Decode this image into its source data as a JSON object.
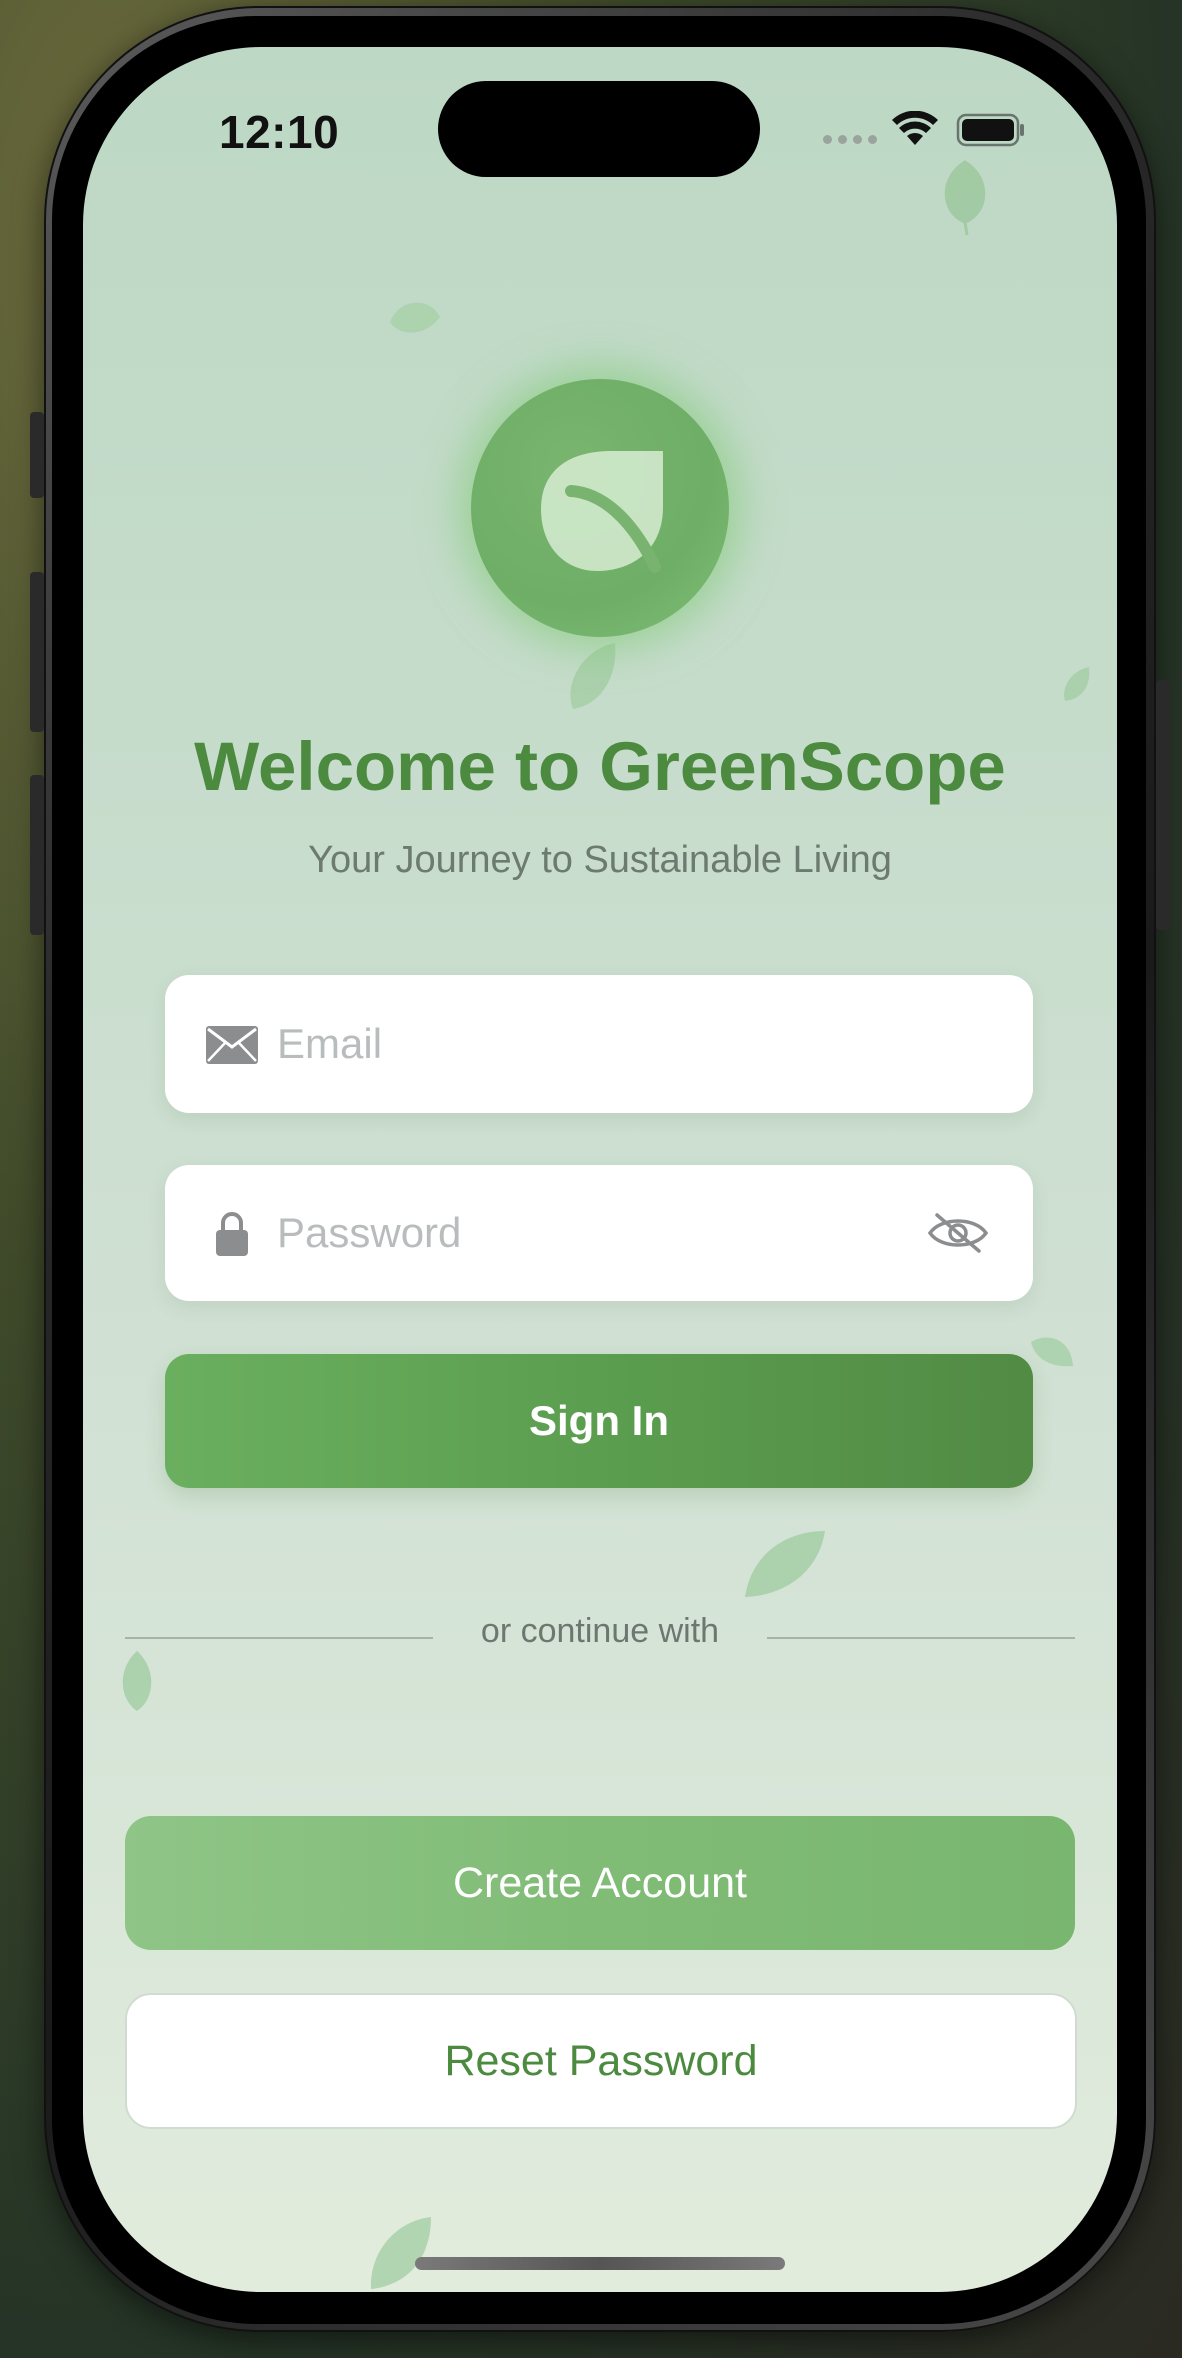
{
  "status_bar": {
    "time": "12:10"
  },
  "header": {
    "logo_icon": "leaf-icon",
    "title": "Welcome to GreenScope",
    "subtitle": "Your Journey to Sustainable Living"
  },
  "form": {
    "email": {
      "placeholder": "Email",
      "value": "",
      "icon": "envelope-icon"
    },
    "password": {
      "placeholder": "Password",
      "value": "",
      "icon": "lock-icon",
      "toggle_icon": "eye-slash-icon"
    },
    "sign_in_label": "Sign In"
  },
  "divider": {
    "text": "or continue with"
  },
  "actions": {
    "create_account_label": "Create Account",
    "reset_password_label": "Reset Password"
  },
  "colors": {
    "brand_green": "#4b8a3f",
    "button_green": "#5a9c4e",
    "light_green": "#80bc76"
  }
}
